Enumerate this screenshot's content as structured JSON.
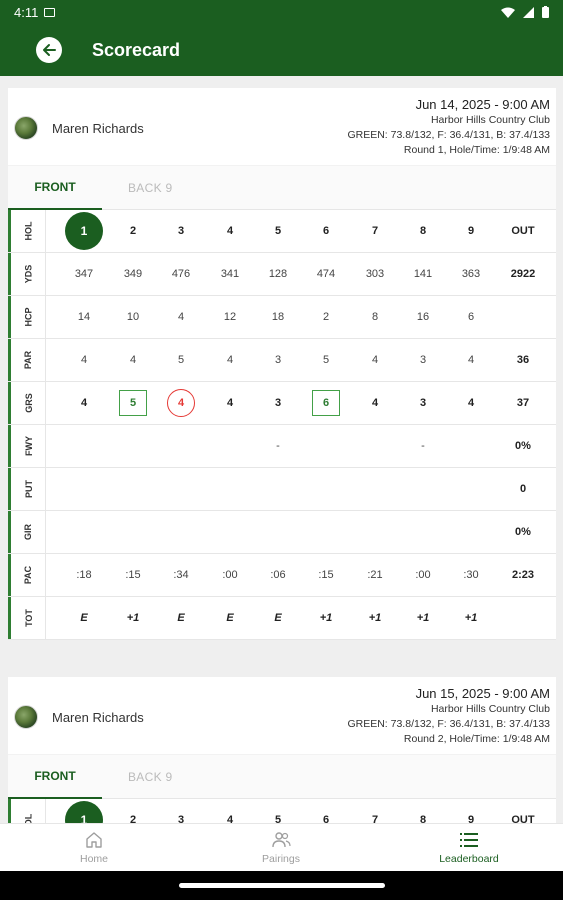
{
  "status": {
    "time": "4:11"
  },
  "appbar": {
    "title": "Scorecard"
  },
  "tabs": {
    "front": "FRONT",
    "back": "BACK 9"
  },
  "row_labels": [
    "HOL",
    "YDS",
    "HCP",
    "PAR",
    "GRS",
    "FWY",
    "PUT",
    "GIR",
    "PAC",
    "TOT"
  ],
  "cards": [
    {
      "player": "Maren Richards",
      "date": "Jun 14, 2025 - 9:00 AM",
      "club": "Harbor Hills Country Club",
      "tees": "GREEN: 73.8/132, F: 36.4/131, B: 37.4/133",
      "round": "Round 1, Hole/Time: 1/9:48 AM",
      "rows": {
        "HOL": [
          "1",
          "2",
          "3",
          "4",
          "5",
          "6",
          "7",
          "8",
          "9",
          "OUT"
        ],
        "YDS": [
          "347",
          "349",
          "476",
          "341",
          "128",
          "474",
          "303",
          "141",
          "363",
          "2922"
        ],
        "HCP": [
          "14",
          "10",
          "4",
          "12",
          "18",
          "2",
          "8",
          "16",
          "6",
          ""
        ],
        "PAR": [
          "4",
          "4",
          "5",
          "4",
          "3",
          "5",
          "4",
          "3",
          "4",
          "36"
        ],
        "GRS": [
          "4",
          "5",
          "4",
          "4",
          "3",
          "6",
          "4",
          "3",
          "4",
          "37"
        ],
        "FWY": [
          "",
          "",
          "",
          "",
          "-",
          "",
          "",
          "-",
          "",
          "0%"
        ],
        "PUT": [
          "",
          "",
          "",
          "",
          "",
          "",
          "",
          "",
          "",
          "0"
        ],
        "GIR": [
          "",
          "",
          "",
          "",
          "",
          "",
          "",
          "",
          "",
          "0%"
        ],
        "PAC": [
          ":18",
          ":15",
          ":34",
          ":00",
          ":06",
          ":15",
          ":21",
          ":00",
          ":30",
          "2:23"
        ],
        "TOT": [
          "E",
          "+1",
          "E",
          "E",
          "E",
          "+1",
          "+1",
          "+1",
          "+1",
          ""
        ]
      },
      "grs_marks": [
        "",
        "square",
        "circle",
        "",
        "",
        "square",
        "",
        "",
        "",
        ""
      ]
    },
    {
      "player": "Maren Richards",
      "date": "Jun 15, 2025 - 9:00 AM",
      "club": "Harbor Hills Country Club",
      "tees": "GREEN: 73.8/132, F: 36.4/131, B: 37.4/133",
      "round": "Round 2, Hole/Time: 1/9:48 AM",
      "rows": {
        "HOL": [
          "1",
          "2",
          "3",
          "4",
          "5",
          "6",
          "7",
          "8",
          "9",
          "OUT"
        ]
      },
      "hol_label_partial": "OL"
    }
  ],
  "nav": {
    "home": "Home",
    "pairings": "Pairings",
    "leaderboard": "Leaderboard"
  },
  "colors": {
    "primary": "#1b5e20",
    "birdie": "#43a047",
    "bogey": "#e53935"
  }
}
